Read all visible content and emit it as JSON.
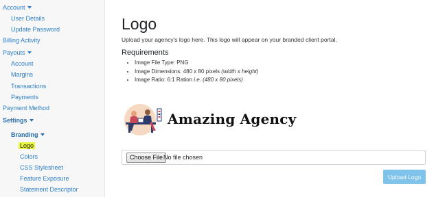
{
  "sidebar": {
    "items": [
      {
        "label": "Account",
        "caret": true
      },
      {
        "label": "User Details"
      },
      {
        "label": "Update Password"
      },
      {
        "label": "Billing Activity"
      },
      {
        "label": "Payouts",
        "caret": true
      },
      {
        "label": "Account"
      },
      {
        "label": "Margins"
      },
      {
        "label": "Transactions"
      },
      {
        "label": "Payments"
      },
      {
        "label": "Payment Method"
      },
      {
        "label": "Settings",
        "caret": true
      },
      {
        "label": "Branding",
        "caret": true
      },
      {
        "label": "Logo",
        "active": true
      },
      {
        "label": "Colors"
      },
      {
        "label": "CSS Stylesheet"
      },
      {
        "label": "Feature Exposure"
      },
      {
        "label": "Statement Descriptor"
      }
    ]
  },
  "main": {
    "title": "Logo",
    "intro": "Upload your agency's logo here. This logo will appear on your branded client portal.",
    "requirements_title": "Requirements",
    "requirements": [
      {
        "text": "Image File Type: PNG",
        "note": ""
      },
      {
        "text": "Image Dimensions: 480 x 80 pixels ",
        "note": "(width x height)"
      },
      {
        "text": "Image Ratio: 6:1 Ration ",
        "note": "i.e. (480 x 80 pixels)"
      }
    ],
    "logo_text": "Amazing Agency",
    "file_input": {
      "button_label": "Choose File",
      "status": "No file chosen"
    },
    "upload_button": "Upload Logo"
  },
  "colors": {
    "link": "#2f80c8",
    "active_highlight": "#e9f53c",
    "upload_button": "#7fc3ea",
    "logo_illustration_bg": "#f6d9c3"
  }
}
